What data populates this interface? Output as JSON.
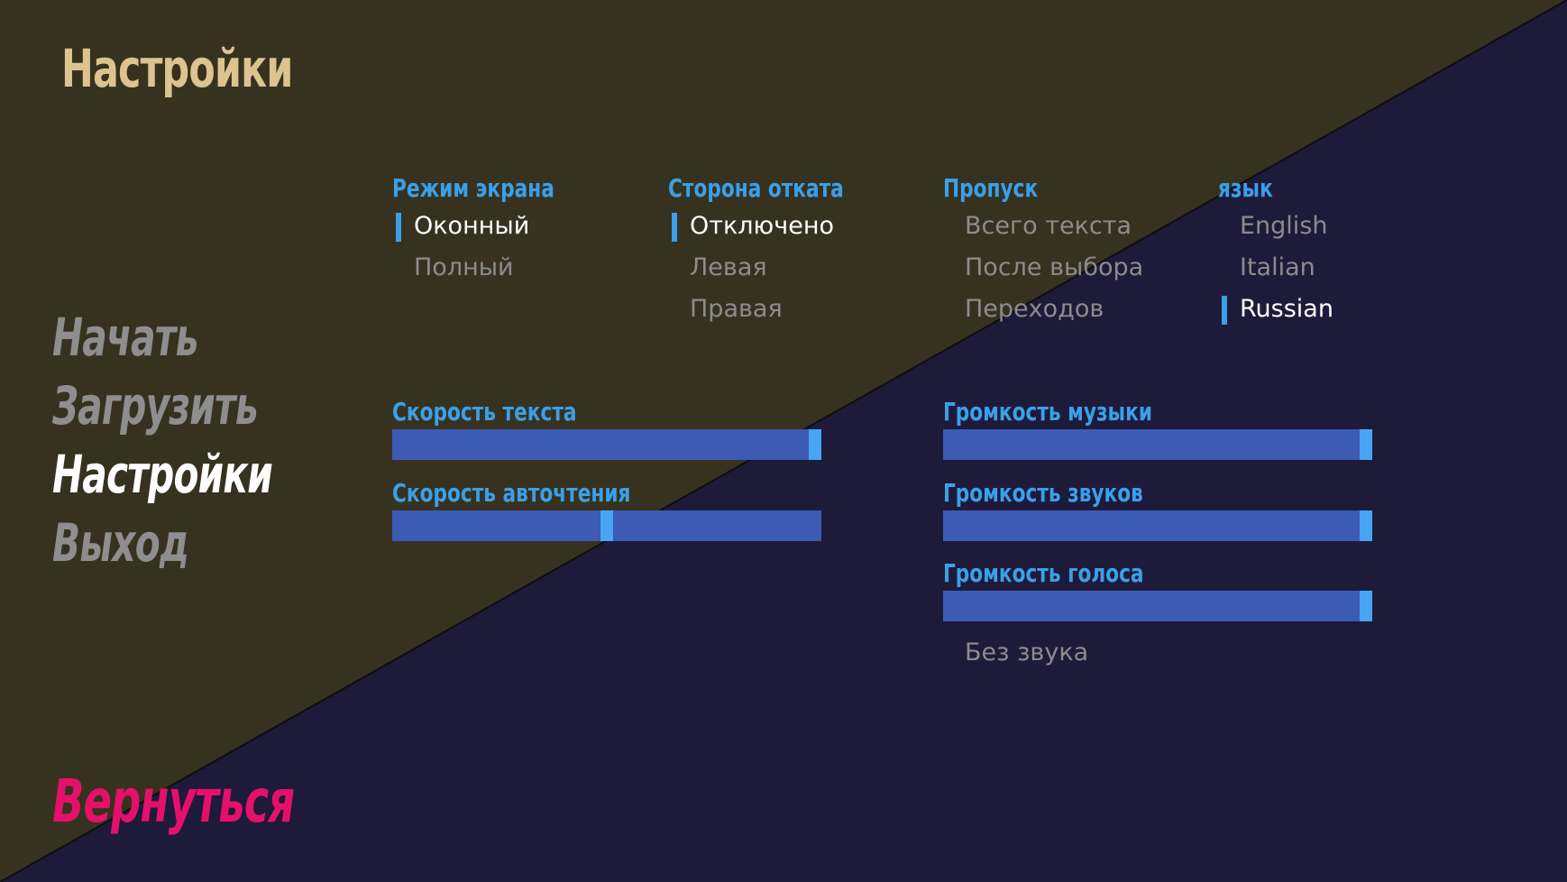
{
  "colors": {
    "bg_top_left": "#36321f",
    "bg_bottom_right": "#1e1a3a",
    "accent": "#3aa0ea",
    "title": "#ddc390",
    "back": "#e5106a",
    "bar": "#3d5ab5",
    "thumb": "#47a5f3"
  },
  "title": "Настройки",
  "main_menu": [
    {
      "label": "Начать",
      "active": false
    },
    {
      "label": "Загрузить",
      "active": false
    },
    {
      "label": "Настройки",
      "active": true
    },
    {
      "label": "Выход",
      "active": false
    }
  ],
  "back_label": "Вернуться",
  "display": {
    "label": "Режим экрана",
    "options": [
      "Оконный",
      "Полный"
    ],
    "selected": "Оконный"
  },
  "rollback": {
    "label": "Сторона отката",
    "options": [
      "Отключено",
      "Левая",
      "Правая"
    ],
    "selected": "Отключено"
  },
  "skip": {
    "label": "Пропуск",
    "options": [
      "Всего текста",
      "После выбора",
      "Переходов"
    ],
    "selected": ""
  },
  "language": {
    "label": "язык",
    "options": [
      "English",
      "Italian",
      "Russian"
    ],
    "selected": "Russian"
  },
  "sliders": {
    "text_speed": {
      "label": "Скорость текста",
      "value": 1.0
    },
    "auto_forward": {
      "label": "Скорость авточтения",
      "value": 0.5
    },
    "music_volume": {
      "label": "Громкость музыки",
      "value": 1.0
    },
    "sound_volume": {
      "label": "Громкость звуков",
      "value": 1.0
    },
    "voice_volume": {
      "label": "Громкость голоса",
      "value": 1.0
    }
  },
  "mute_label": "Без звука"
}
